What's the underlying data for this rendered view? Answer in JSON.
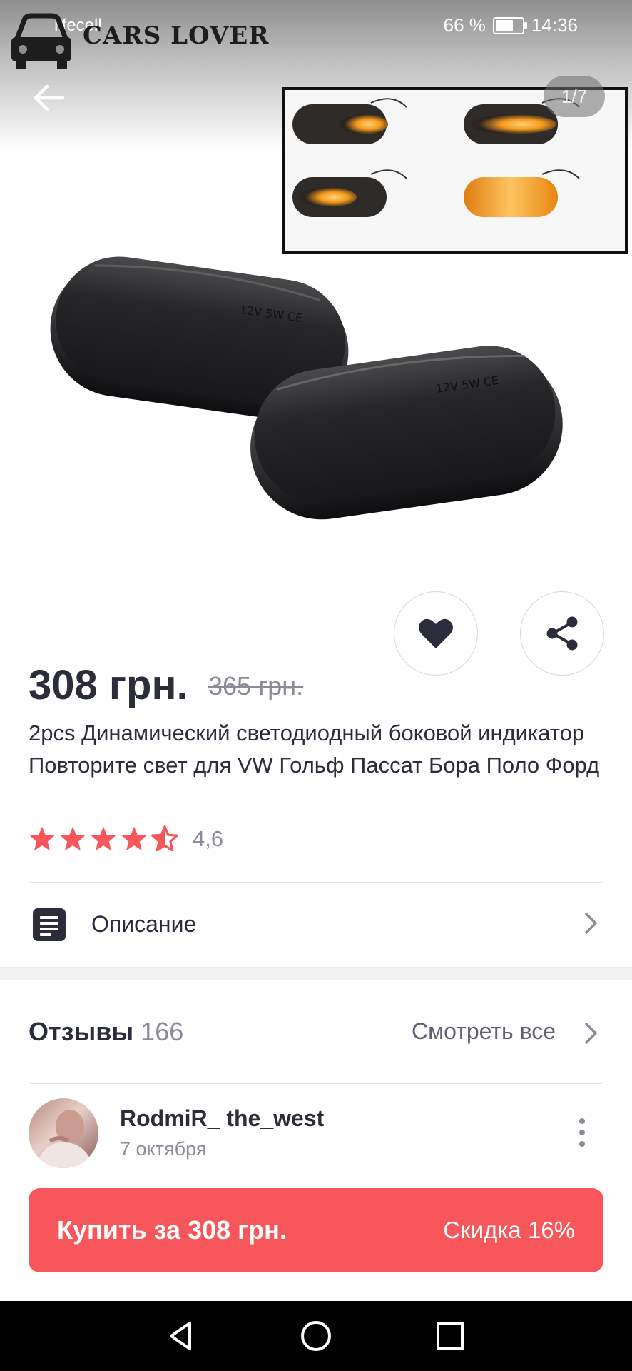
{
  "status_bar": {
    "carrier": "lifecell",
    "battery": "66 %",
    "time": "14:36"
  },
  "watermark": {
    "text": "CARS LOVER"
  },
  "gallery": {
    "counter": "1/7"
  },
  "product": {
    "price": "308 грн.",
    "old_price": "365 грн.",
    "title": "2pcs Динамический светодиодный боковой индикатор Повторите свет для VW Гольф Пассат Бора Поло Форд",
    "rating": "4,6",
    "rating_value": 4.6,
    "description_label": "Описание"
  },
  "reviews": {
    "title": "Отзывы",
    "count": "166",
    "see_all": "Смотреть все",
    "first": {
      "author": "RodmiR_ the_west",
      "date": "7 октября"
    }
  },
  "buy_bar": {
    "label": "Купить за 308 грн.",
    "discount": "Скидка 16%"
  },
  "colors": {
    "accent": "#f7575b",
    "star": "#f7575b",
    "text": "#2b2d3a",
    "muted": "#8b8c97"
  }
}
